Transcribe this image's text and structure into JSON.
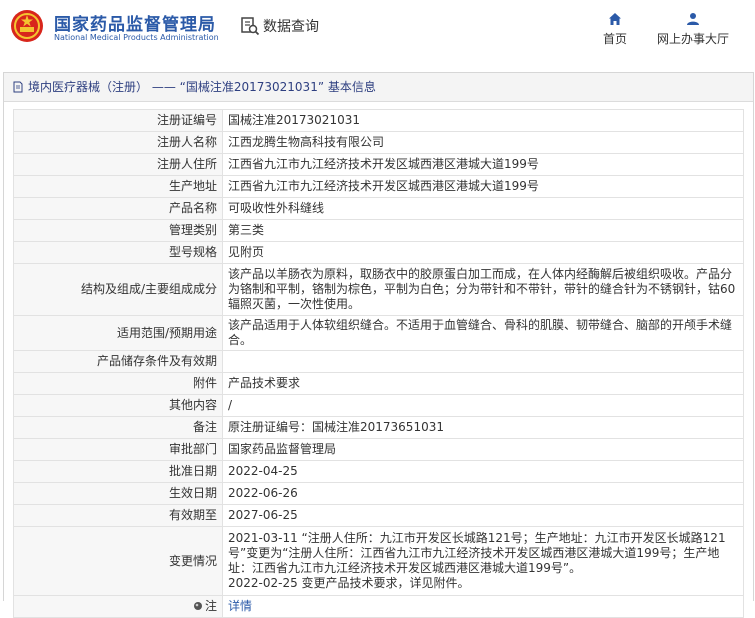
{
  "header": {
    "brand_cn": "国家药品监督管理局",
    "brand_en": "National Medical Products Administration",
    "data_query": "数据查询",
    "nav": {
      "home": "首页",
      "online_hall": "网上办事大厅"
    }
  },
  "breadcrumb": "境内医疗器械（注册） —— “国械注准20173021031” 基本信息",
  "rows": [
    {
      "label": "注册证编号",
      "value": "国械注准20173021031"
    },
    {
      "label": "注册人名称",
      "value": "江西龙腾生物高科技有限公司"
    },
    {
      "label": "注册人住所",
      "value": "江西省九江市九江经济技术开发区城西港区港城大道199号"
    },
    {
      "label": "生产地址",
      "value": "江西省九江市九江经济技术开发区城西港区港城大道199号"
    },
    {
      "label": "产品名称",
      "value": "可吸收性外科缝线"
    },
    {
      "label": "管理类别",
      "value": "第三类"
    },
    {
      "label": "型号规格",
      "value": "见附页"
    },
    {
      "label": "结构及组成/主要组成成分",
      "value": "该产品以羊肠衣为原料，取肠衣中的胶原蛋白加工而成，在人体内经酶解后被组织吸收。产品分为铬制和平制，铬制为棕色，平制为白色；分为带针和不带针，带针的缝合针为不锈钢针，钴60辐照灭菌，一次性使用。"
    },
    {
      "label": "适用范围/预期用途",
      "value": "该产品适用于人体软组织缝合。不适用于血管缝合、骨科的肌膜、韧带缝合、脑部的开颅手术缝合。"
    },
    {
      "label": "产品储存条件及有效期",
      "value": ""
    },
    {
      "label": "附件",
      "value": "产品技术要求"
    },
    {
      "label": "其他内容",
      "value": "/"
    },
    {
      "label": "备注",
      "value": "原注册证编号：国械注准20173651031"
    },
    {
      "label": "审批部门",
      "value": "国家药品监督管理局"
    },
    {
      "label": "批准日期",
      "value": "2022-04-25"
    },
    {
      "label": "生效日期",
      "value": "2022-06-26"
    },
    {
      "label": "有效期至",
      "value": "2027-06-25"
    },
    {
      "label": "变更情况",
      "value": "2021-03-11 “注册人住所：九江市开发区长城路121号；生产地址：九江市开发区长城路121号”变更为“注册人住所：江西省九江市九江经济技术开发区城西港区港城大道199号；生产地址：江西省九江市九江经济技术开发区城西港区港城大道199号”。\n2022-02-25 变更产品技术要求，详见附件。"
    }
  ],
  "note": {
    "label": "注",
    "link": "详情"
  },
  "colors": {
    "brand_blue": "#2b5aa8",
    "emblem_red": "#d8261c",
    "label_bg": "#f7f7f7"
  }
}
